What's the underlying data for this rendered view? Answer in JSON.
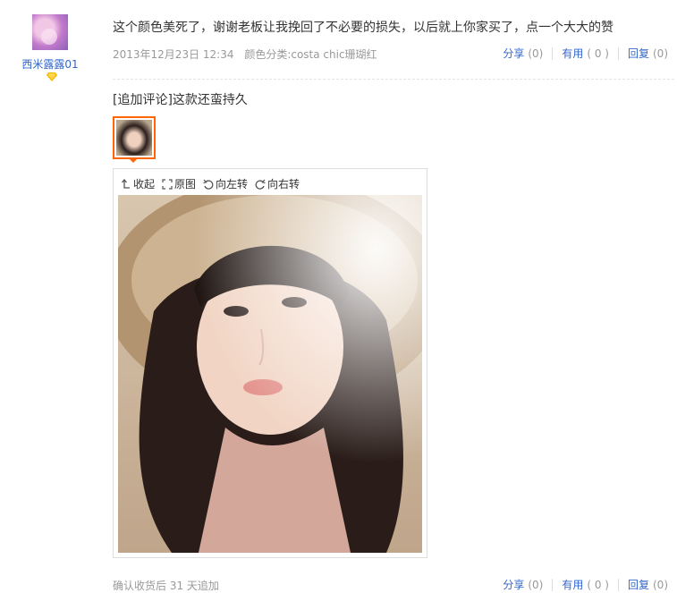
{
  "review": {
    "user": {
      "name": "西米露露01"
    },
    "text": "这个颜色美死了，谢谢老板让我挽回了不必要的损失，以后就上你家买了，点一个大大的赞",
    "date": "2013年12月23日 12:34",
    "color_info": "颜色分类:costa chic珊瑚红",
    "actions": {
      "share_label": "分享",
      "share_count": "(0)",
      "useful_label": "有用",
      "useful_count": "( 0 )",
      "reply_label": "回复",
      "reply_count": "(0)"
    }
  },
  "append": {
    "text": "[追加评论]这款还蛮持久",
    "viewer": {
      "collapse_label": "收起",
      "original_label": "原图",
      "rotate_left_label": "向左转",
      "rotate_right_label": "向右转"
    },
    "footer_note": "确认收货后 31 天追加",
    "actions": {
      "share_label": "分享",
      "share_count": "(0)",
      "useful_label": "有用",
      "useful_count": "( 0 )",
      "reply_label": "回复",
      "reply_count": "(0)"
    }
  },
  "colors": {
    "link": "#3366cc",
    "muted": "#999999",
    "highlight": "#ff6600"
  },
  "icons": [
    "diamond-icon",
    "collapse-icon",
    "fullsize-icon",
    "rotate-left-icon",
    "rotate-right-icon"
  ]
}
